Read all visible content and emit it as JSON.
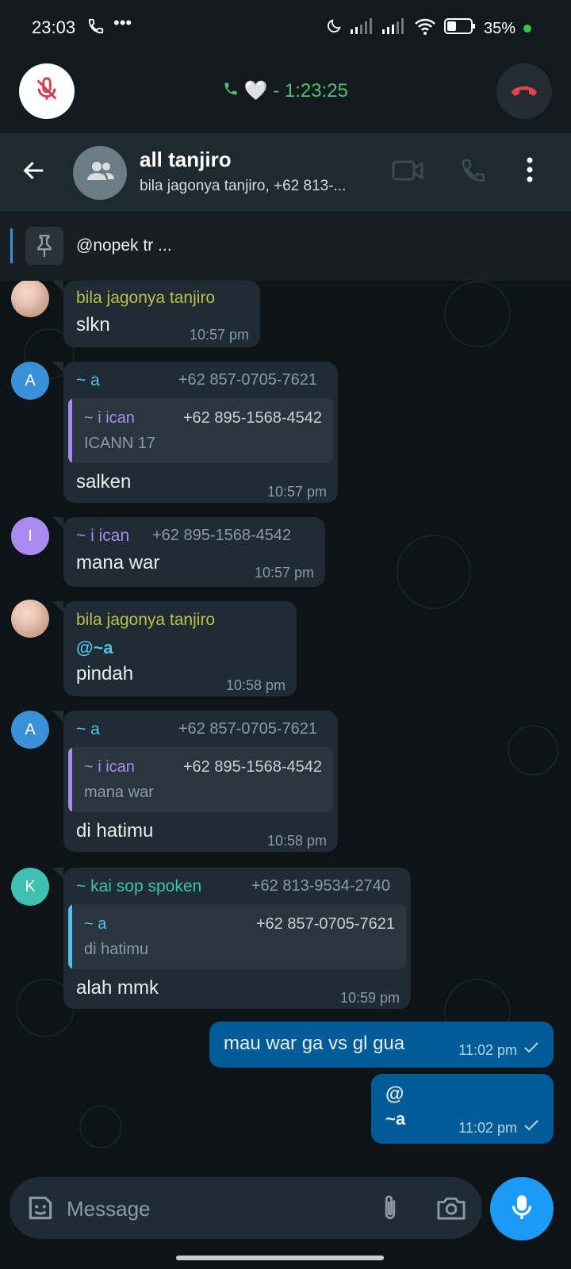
{
  "status_bar": {
    "time": "23:03",
    "battery": "35%"
  },
  "call": {
    "label": "🤍 - 1:23:25"
  },
  "header": {
    "title": "all tanjiro",
    "subtitle": "bila jagonya tanjiro, +62 813-..."
  },
  "pinned": {
    "text": "@nopek tr ..."
  },
  "messages": [
    {
      "sender": "bila jagonya tanjiro",
      "text": "slkn",
      "time": "10:57 pm"
    },
    {
      "sender": "~ a",
      "phone": "+62 857-0705-7621",
      "avatar": "A",
      "quote": {
        "name": "~ i ican",
        "phone": "+62 895-1568-4542",
        "text": "ICANN 17"
      },
      "text": "salken",
      "time": "10:57 pm"
    },
    {
      "sender": "~ i ican",
      "phone": "+62 895-1568-4542",
      "avatar": "I",
      "text": "mana war",
      "time": "10:57 pm"
    },
    {
      "sender": "bila jagonya tanjiro",
      "mention": "@~a",
      "text": "pindah",
      "time": "10:58 pm"
    },
    {
      "sender": "~ a",
      "phone": "+62 857-0705-7621",
      "avatar": "A",
      "quote": {
        "name": "~ i ican",
        "phone": "+62 895-1568-4542",
        "text": "mana war"
      },
      "text": "di hatimu",
      "time": "10:58 pm"
    },
    {
      "sender": "~ kai sop spoken",
      "phone": "+62 813-9534-2740",
      "avatar": "K",
      "quote": {
        "name": "~ a",
        "phone": "+62 857-0705-7621",
        "text": "di hatimu"
      },
      "text": "alah mmk",
      "time": "10:59 pm"
    },
    {
      "outgoing": true,
      "text": "mau war ga vs gl gua",
      "time": "11:02 pm"
    },
    {
      "outgoing": true,
      "line1": "@",
      "line2": "~a",
      "time": "11:02 pm"
    }
  ],
  "composer": {
    "placeholder": "Message"
  },
  "colors": {
    "sender_olive": "#b9c04d",
    "sender_blue": "#53bdeb",
    "sender_purple": "#a98bf0",
    "sender_teal": "#3fc0b0",
    "outgoing_bubble": "#005c96",
    "incoming_bubble": "#1f2c33",
    "end_call": "#e8424b"
  },
  "icons": [
    "phone-icon",
    "more-icon",
    "moon-icon",
    "signal-icon",
    "wifi-icon",
    "battery-icon",
    "mic-off-icon",
    "call-end-icon",
    "back-arrow-icon",
    "group-icon",
    "video-call-icon",
    "voice-call-icon",
    "menu-dots-icon",
    "pin-icon",
    "sticker-icon",
    "attach-icon",
    "camera-icon",
    "mic-icon",
    "checkmark-icon"
  ]
}
